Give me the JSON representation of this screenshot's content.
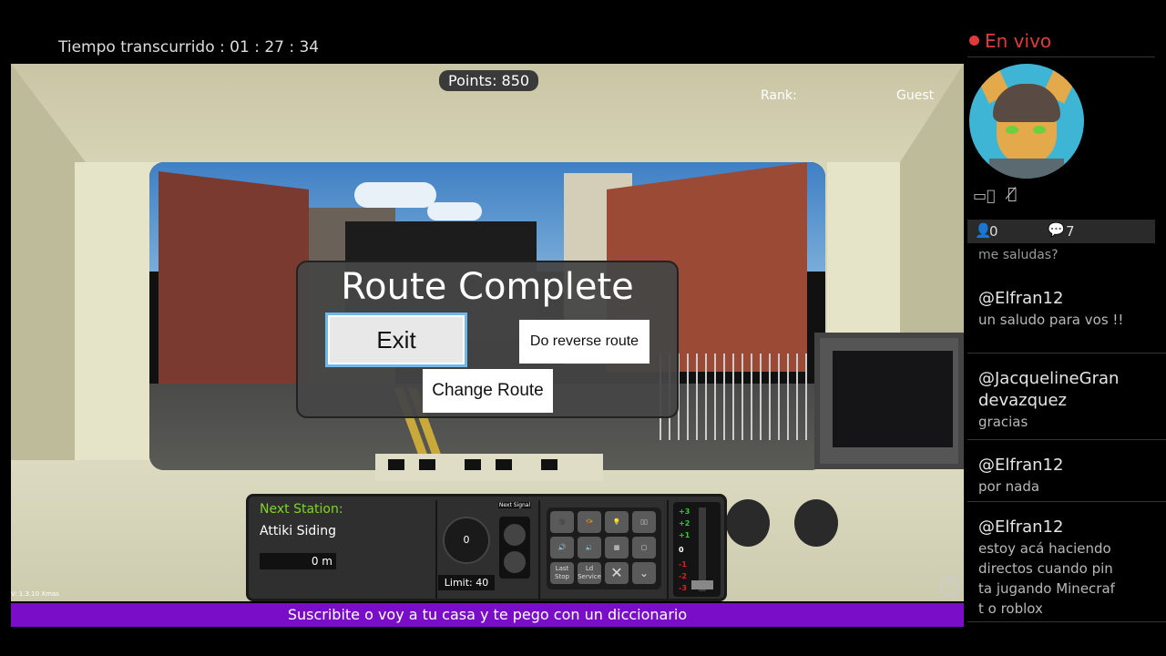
{
  "stream": {
    "elapsed_label": "Tiempo transcurrido :  01 : 27 : 34",
    "live_label": "En vivo",
    "viewers": "0",
    "comments": "7",
    "ticker": "Suscribite o voy a tu casa y te pego con un diccionario"
  },
  "game": {
    "points": "Points: 850",
    "rank_label": "Rank:",
    "player": "Guest",
    "sign_glyph": "Σ",
    "version": "V: 1.3.10 Xmas",
    "help": "?"
  },
  "dialog": {
    "title": "Route Complete",
    "exit": "Exit",
    "reverse": "Do reverse route",
    "change": "Change Route"
  },
  "hud": {
    "next_station_label": "Next Station:",
    "next_station": "Attiki Siding",
    "distance": "0 m",
    "speed": "0",
    "limit": "Limit:  40",
    "next_signal_label": "Next Signal",
    "last_stop": "Last Stop",
    "door_service": "Ld Service",
    "throttle_labels": [
      "+3",
      "+2",
      "+1",
      "0",
      "-1",
      "-2",
      "-3"
    ]
  },
  "chat": {
    "cutoff_text": "me saludas?",
    "messages": [
      {
        "user": "@Elfran12",
        "text": "un saludo para vos !!"
      },
      {
        "user": "@JacquelineGrandevazquez",
        "text": "gracias"
      },
      {
        "user": "@Elfran12",
        "text": "por nada"
      },
      {
        "user": "@Elfran12",
        "text": "estoy acá haciendo directos cuando pinta jugando Minecraft o roblox"
      }
    ]
  },
  "colors": {
    "live": "#e03a3a",
    "ticker": "#7a0ec8",
    "next_station": "#7fd62a",
    "throttle_positive": "#33cc33",
    "throttle_negative": "#e02020"
  }
}
